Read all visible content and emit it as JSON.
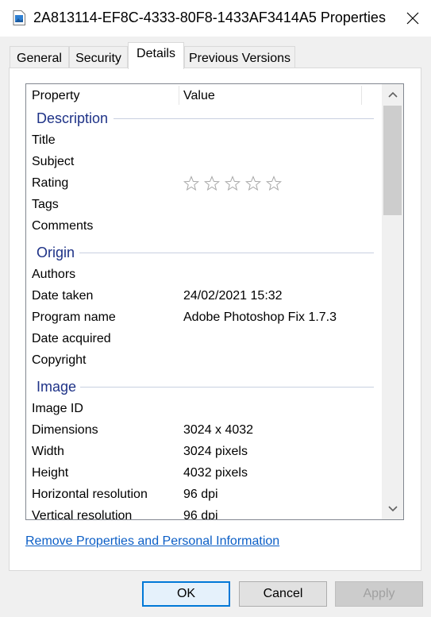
{
  "window": {
    "title": "2A813114-EF8C-4333-80F8-1433AF3414A5 Properties"
  },
  "tabs": [
    {
      "label": "General"
    },
    {
      "label": "Security"
    },
    {
      "label": "Details"
    },
    {
      "label": "Previous Versions"
    }
  ],
  "active_tab": "Details",
  "list": {
    "header": {
      "property": "Property",
      "value": "Value"
    },
    "groups": {
      "description": {
        "title": "Description",
        "rows": [
          {
            "label": "Title",
            "value": ""
          },
          {
            "label": "Subject",
            "value": ""
          },
          {
            "label": "Rating",
            "value": ""
          },
          {
            "label": "Tags",
            "value": ""
          },
          {
            "label": "Comments",
            "value": ""
          }
        ]
      },
      "origin": {
        "title": "Origin",
        "rows": [
          {
            "label": "Authors",
            "value": ""
          },
          {
            "label": "Date taken",
            "value": "24/02/2021 15:32"
          },
          {
            "label": "Program name",
            "value": "Adobe Photoshop Fix 1.7.3"
          },
          {
            "label": "Date acquired",
            "value": ""
          },
          {
            "label": "Copyright",
            "value": ""
          }
        ]
      },
      "image": {
        "title": "Image",
        "rows": [
          {
            "label": "Image ID",
            "value": ""
          },
          {
            "label": "Dimensions",
            "value": "3024 x 4032"
          },
          {
            "label": "Width",
            "value": "3024 pixels"
          },
          {
            "label": "Height",
            "value": "4032 pixels"
          },
          {
            "label": "Horizontal resolution",
            "value": "96 dpi"
          },
          {
            "label": "Vertical resolution",
            "value": "96 dpi"
          }
        ]
      }
    },
    "rating_stars": 0,
    "rating_max": 5
  },
  "link": "Remove Properties and Personal Information",
  "buttons": {
    "ok": "OK",
    "cancel": "Cancel",
    "apply": "Apply"
  },
  "colors": {
    "accent": "#0078d7",
    "group": "#1e3287",
    "link": "#0b5ec6"
  }
}
